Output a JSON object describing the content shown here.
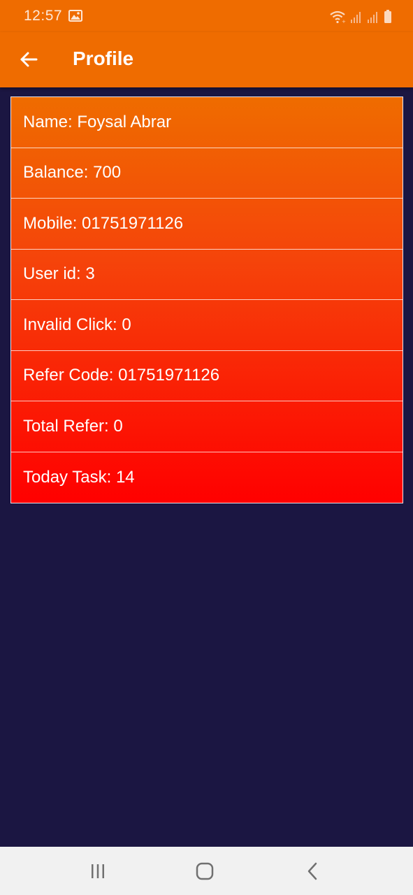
{
  "status_bar": {
    "time": "12:57",
    "icons": [
      "gallery-icon",
      "wifi-icon",
      "signal-icon",
      "signal-icon",
      "battery-icon"
    ]
  },
  "app_bar": {
    "title": "Profile",
    "back_icon": "arrow-back-icon"
  },
  "profile": {
    "rows": [
      {
        "label": "Name: Foysal Abrar"
      },
      {
        "label": "Balance: 700"
      },
      {
        "label": "Mobile: 01751971126"
      },
      {
        "label": "User id: 3"
      },
      {
        "label": "Invalid Click: 0"
      },
      {
        "label": "Refer Code: 01751971126"
      },
      {
        "label": "Total Refer: 0"
      },
      {
        "label": "Today Task: 14"
      }
    ]
  },
  "nav_bar": {
    "icons": [
      "recents-icon",
      "home-icon",
      "back-icon"
    ]
  },
  "colors": {
    "app_bar": "#ef6c00",
    "background": "#1b1642",
    "card_top": "#ef6c00",
    "card_bottom": "#ff0000",
    "nav_bar": "#f1f1f1"
  }
}
